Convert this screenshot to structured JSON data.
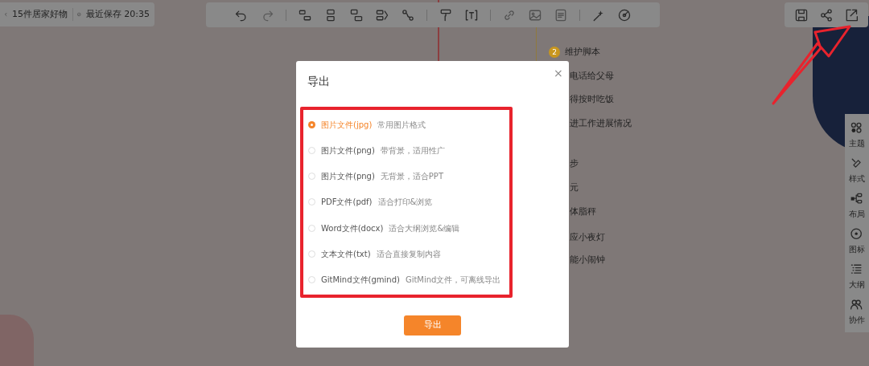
{
  "header": {
    "back_title": "15件居家好物",
    "save_status": "最近保存 20:35"
  },
  "mindmap_nodes": [
    {
      "text": "维护脚本",
      "badge": "2",
      "color": "#c8961e"
    },
    {
      "text": "电话给父母"
    },
    {
      "text": "得按时吃饭"
    },
    {
      "text": "进工作进展情况"
    },
    {
      "text": "步"
    },
    {
      "text": "元"
    },
    {
      "text": "体脂秤"
    },
    {
      "text": "应小夜灯"
    },
    {
      "text": "能小闹钟"
    }
  ],
  "side_panel": [
    {
      "label": "主题"
    },
    {
      "label": "样式"
    },
    {
      "label": "布局"
    },
    {
      "label": "图标"
    },
    {
      "label": "大纲"
    },
    {
      "label": "协作"
    }
  ],
  "dialog": {
    "title": "导出",
    "close": "×",
    "options": [
      {
        "label": "图片文件(jpg)",
        "hint": "常用图片格式",
        "selected": true
      },
      {
        "label": "图片文件(png)",
        "hint": "带背景，适用性广",
        "selected": false
      },
      {
        "label": "图片文件(png)",
        "hint": "无背景，适合PPT",
        "selected": false
      },
      {
        "label": "PDF文件(pdf)",
        "hint": "适合打印&浏览",
        "selected": false
      },
      {
        "label": "Word文件(docx)",
        "hint": "适合大纲浏览&编辑",
        "selected": false
      },
      {
        "label": "文本文件(txt)",
        "hint": "适合直接复制内容",
        "selected": false
      },
      {
        "label": "GitMind文件(gmind)",
        "hint": "GitMind文件，可离线导出",
        "selected": false
      }
    ],
    "button": "导出"
  }
}
